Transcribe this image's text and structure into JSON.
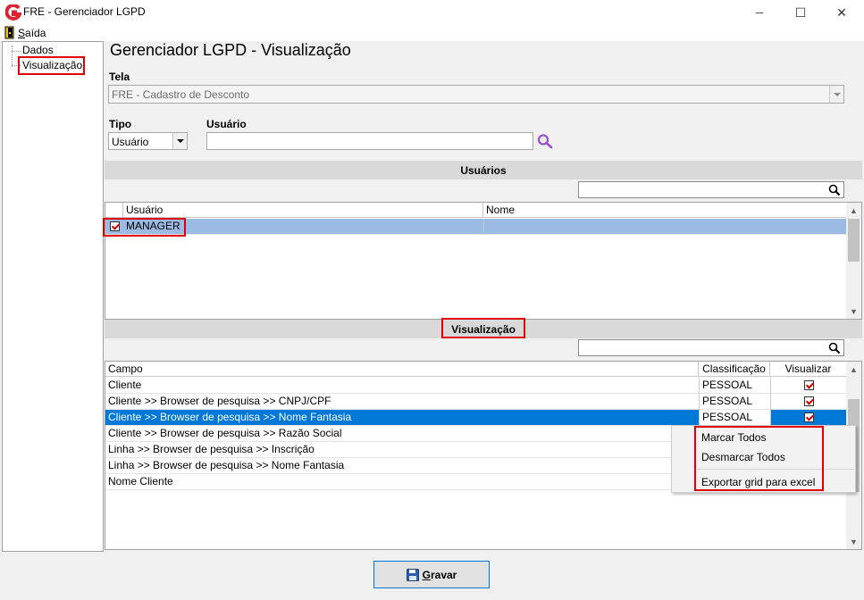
{
  "window": {
    "title": "FRE - Gerenciador LGPD",
    "minimize": "─",
    "maximize": "☐",
    "close": "✕"
  },
  "menu": {
    "exit_first": "S",
    "exit_rest": "aída"
  },
  "tree": {
    "items": [
      {
        "label": "Dados"
      },
      {
        "label": "Visualização"
      }
    ]
  },
  "page": {
    "title": "Gerenciador LGPD - Visualização"
  },
  "tela": {
    "label": "Tela",
    "value": "FRE - Cadastro de Desconto"
  },
  "tipo": {
    "label": "Tipo",
    "value": "Usuário"
  },
  "usuario_filter": {
    "label": "Usuário",
    "value": ""
  },
  "users_section": {
    "title": "Usuários",
    "search_value": "",
    "columns": [
      "Usuário",
      "Nome"
    ],
    "rows": [
      {
        "checked": true,
        "usuario": "MANAGER",
        "nome": ""
      }
    ]
  },
  "view_section": {
    "title": "Visualização",
    "search_value": "",
    "columns": [
      "Campo",
      "Classificação",
      "Visualizar"
    ],
    "rows": [
      {
        "campo": "Cliente",
        "classificacao": "PESSOAL",
        "visualizar": true
      },
      {
        "campo": "Cliente >> Browser de pesquisa >> CNPJ/CPF",
        "classificacao": "PESSOAL",
        "visualizar": true
      },
      {
        "campo": "Cliente >> Browser de pesquisa >> Nome Fantasia",
        "classificacao": "PESSOAL",
        "visualizar": true,
        "selected": true
      },
      {
        "campo": "Cliente >> Browser de pesquisa >> Razão Social",
        "classificacao": "",
        "visualizar": null
      },
      {
        "campo": "Linha >> Browser de pesquisa >> Inscrição",
        "classificacao": "",
        "visualizar": null
      },
      {
        "campo": "Linha >> Browser de pesquisa >> Nome Fantasia",
        "classificacao": "",
        "visualizar": null
      },
      {
        "campo": "Nome Cliente",
        "classificacao": "",
        "visualizar": null
      }
    ]
  },
  "context_menu": {
    "items": [
      "Marcar Todos",
      "Desmarcar Todos",
      "Exportar grid para excel"
    ]
  },
  "footer": {
    "save_first": "G",
    "save_rest": "ravar"
  },
  "colors": {
    "highlight": "#e00000",
    "selection": "#0078d7",
    "accent_purple": "#9b4fc9",
    "logo_red": "#d9232e"
  }
}
